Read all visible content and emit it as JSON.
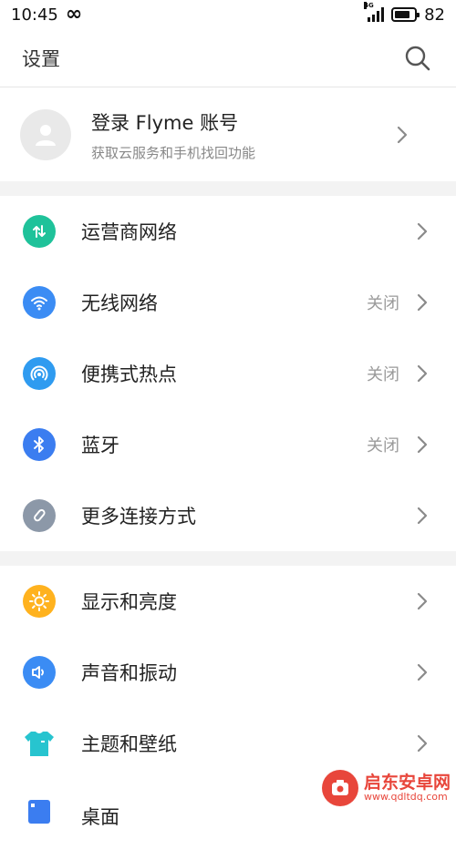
{
  "status_bar": {
    "time": "10:45",
    "network": "4G",
    "battery": "82",
    "battery_level": 0.82
  },
  "header": {
    "title": "设置",
    "search_icon": "search-icon"
  },
  "account": {
    "title": "登录 Flyme 账号",
    "subtitle": "获取云服务和手机找回功能"
  },
  "settings": [
    {
      "label": "运营商网络",
      "status": "",
      "icon": "mobile-data-icon",
      "color": "#1fc29a"
    },
    {
      "label": "无线网络",
      "status": "关闭",
      "icon": "wifi-icon",
      "color": "#3b8cf4"
    },
    {
      "label": "便携式热点",
      "status": "关闭",
      "icon": "hotspot-icon",
      "color": "#2f9bf0"
    },
    {
      "label": "蓝牙",
      "status": "关闭",
      "icon": "bluetooth-icon",
      "color": "#3b7df0"
    },
    {
      "label": "更多连接方式",
      "status": "",
      "icon": "link-icon",
      "color": "#8c98a8"
    },
    {
      "label": "显示和亮度",
      "status": "",
      "icon": "brightness-icon",
      "color": "#ffb21e"
    },
    {
      "label": "声音和振动",
      "status": "",
      "icon": "sound-icon",
      "color": "#3b8cf4"
    },
    {
      "label": "主题和壁纸",
      "status": "",
      "icon": "theme-icon",
      "color": "#27c4cf"
    },
    {
      "label": "桌面",
      "status": "",
      "icon": "desktop-icon",
      "color": "#3b7df0"
    }
  ],
  "watermark": {
    "title": "启东安卓网",
    "url": "www.qdltdq.com"
  }
}
